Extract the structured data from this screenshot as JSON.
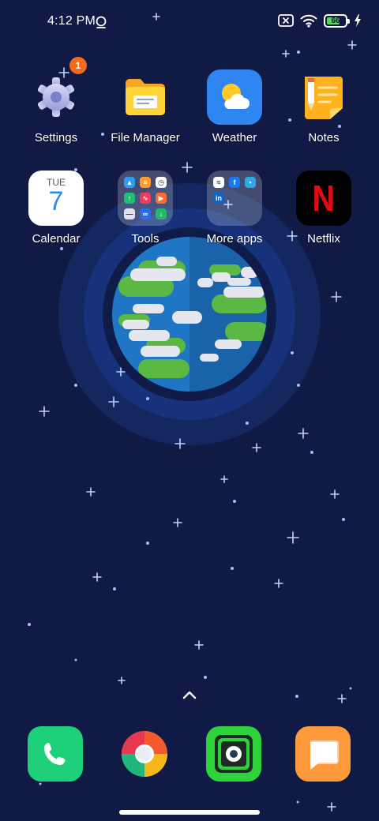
{
  "status_bar": {
    "time": "4:12 PM",
    "battery_level": "66",
    "icons": [
      "alarm-icon",
      "no-sim-icon",
      "wifi-icon",
      "battery-icon",
      "charging-icon"
    ]
  },
  "apps": [
    {
      "label": "Settings",
      "icon": "gear-icon",
      "badge": "1"
    },
    {
      "label": "File Manager",
      "icon": "folder-icon"
    },
    {
      "label": "Weather",
      "icon": "sun-cloud-icon"
    },
    {
      "label": "Notes",
      "icon": "notepad-icon"
    },
    {
      "label": "Calendar",
      "icon": "calendar-icon",
      "day": "TUE",
      "date": "7"
    },
    {
      "label": "Tools",
      "icon": "tools-folder-icon"
    },
    {
      "label": "More apps",
      "icon": "more-apps-folder-icon"
    },
    {
      "label": "Netflix",
      "icon": "netflix-icon",
      "letter": "N"
    }
  ],
  "dock": [
    {
      "name": "Phone",
      "icon": "phone-icon"
    },
    {
      "name": "Browser",
      "icon": "browser-icon"
    },
    {
      "name": "Camera",
      "icon": "camera-icon"
    },
    {
      "name": "Messages",
      "icon": "messages-icon"
    }
  ],
  "colors": {
    "background": "#111a45",
    "badge": "#f26a1b",
    "netflix_red": "#e50914",
    "phone_green": "#1fd07a",
    "calendar_blue": "#2b8cf0"
  }
}
